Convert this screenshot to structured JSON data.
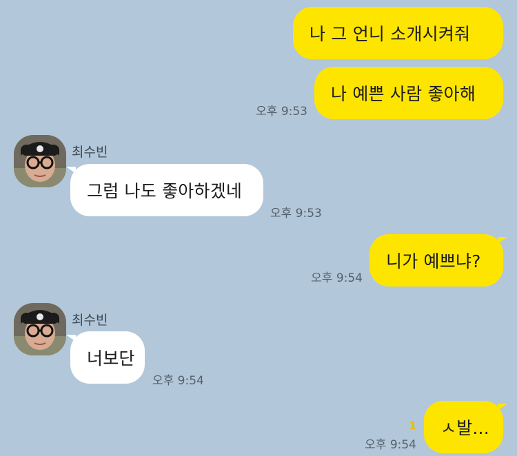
{
  "colors": {
    "background": "#b2c7d9",
    "my_bubble": "#fee500",
    "other_bubble": "#ffffff",
    "unread_count": "#e5c000"
  },
  "messages": [
    {
      "from": "me",
      "text": "나 그 언니 소개시켜줘"
    },
    {
      "from": "me",
      "text": "나 예쁜 사람 좋아해",
      "time": "오후 9:53"
    },
    {
      "from": "other",
      "sender": "최수빈",
      "text": "그럼 나도 좋아하겠네",
      "time": "오후 9:53"
    },
    {
      "from": "me",
      "text": "니가 예쁘냐?",
      "time": "오후 9:54"
    },
    {
      "from": "other",
      "sender": "최수빈",
      "text": "너보단",
      "time": "오후 9:54"
    },
    {
      "from": "me",
      "text": "ㅅ발...",
      "time": "오후 9:54",
      "unread": "1"
    }
  ],
  "avatar": {
    "icon": "profile-photo-icon"
  }
}
